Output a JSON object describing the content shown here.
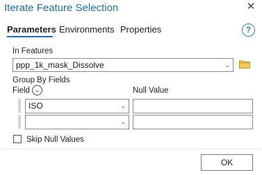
{
  "window": {
    "title": "Iterate Feature Selection"
  },
  "tabs": [
    {
      "label": "Parameters",
      "active": true
    },
    {
      "label": "Environments",
      "active": false
    },
    {
      "label": "Properties",
      "active": false
    }
  ],
  "params": {
    "in_features_label": "In Features",
    "in_features_value": "ppp_1k_mask_Dissolve",
    "group_by_label": "Group By Fields",
    "field_header": "Field",
    "null_value_header": "Null Value",
    "rows": [
      {
        "field": "ISO",
        "null_value": ""
      },
      {
        "field": "",
        "null_value": ""
      }
    ],
    "skip_null_label": "Skip Null Values",
    "skip_null_checked": false
  },
  "footer": {
    "ok_label": "OK"
  },
  "icons": {
    "close": "close-icon",
    "help": "help-icon",
    "folder": "folder-icon",
    "chevron": "chevron-down-icon"
  },
  "colors": {
    "accent": "#1f6fb5",
    "folder": "#e2b247"
  }
}
